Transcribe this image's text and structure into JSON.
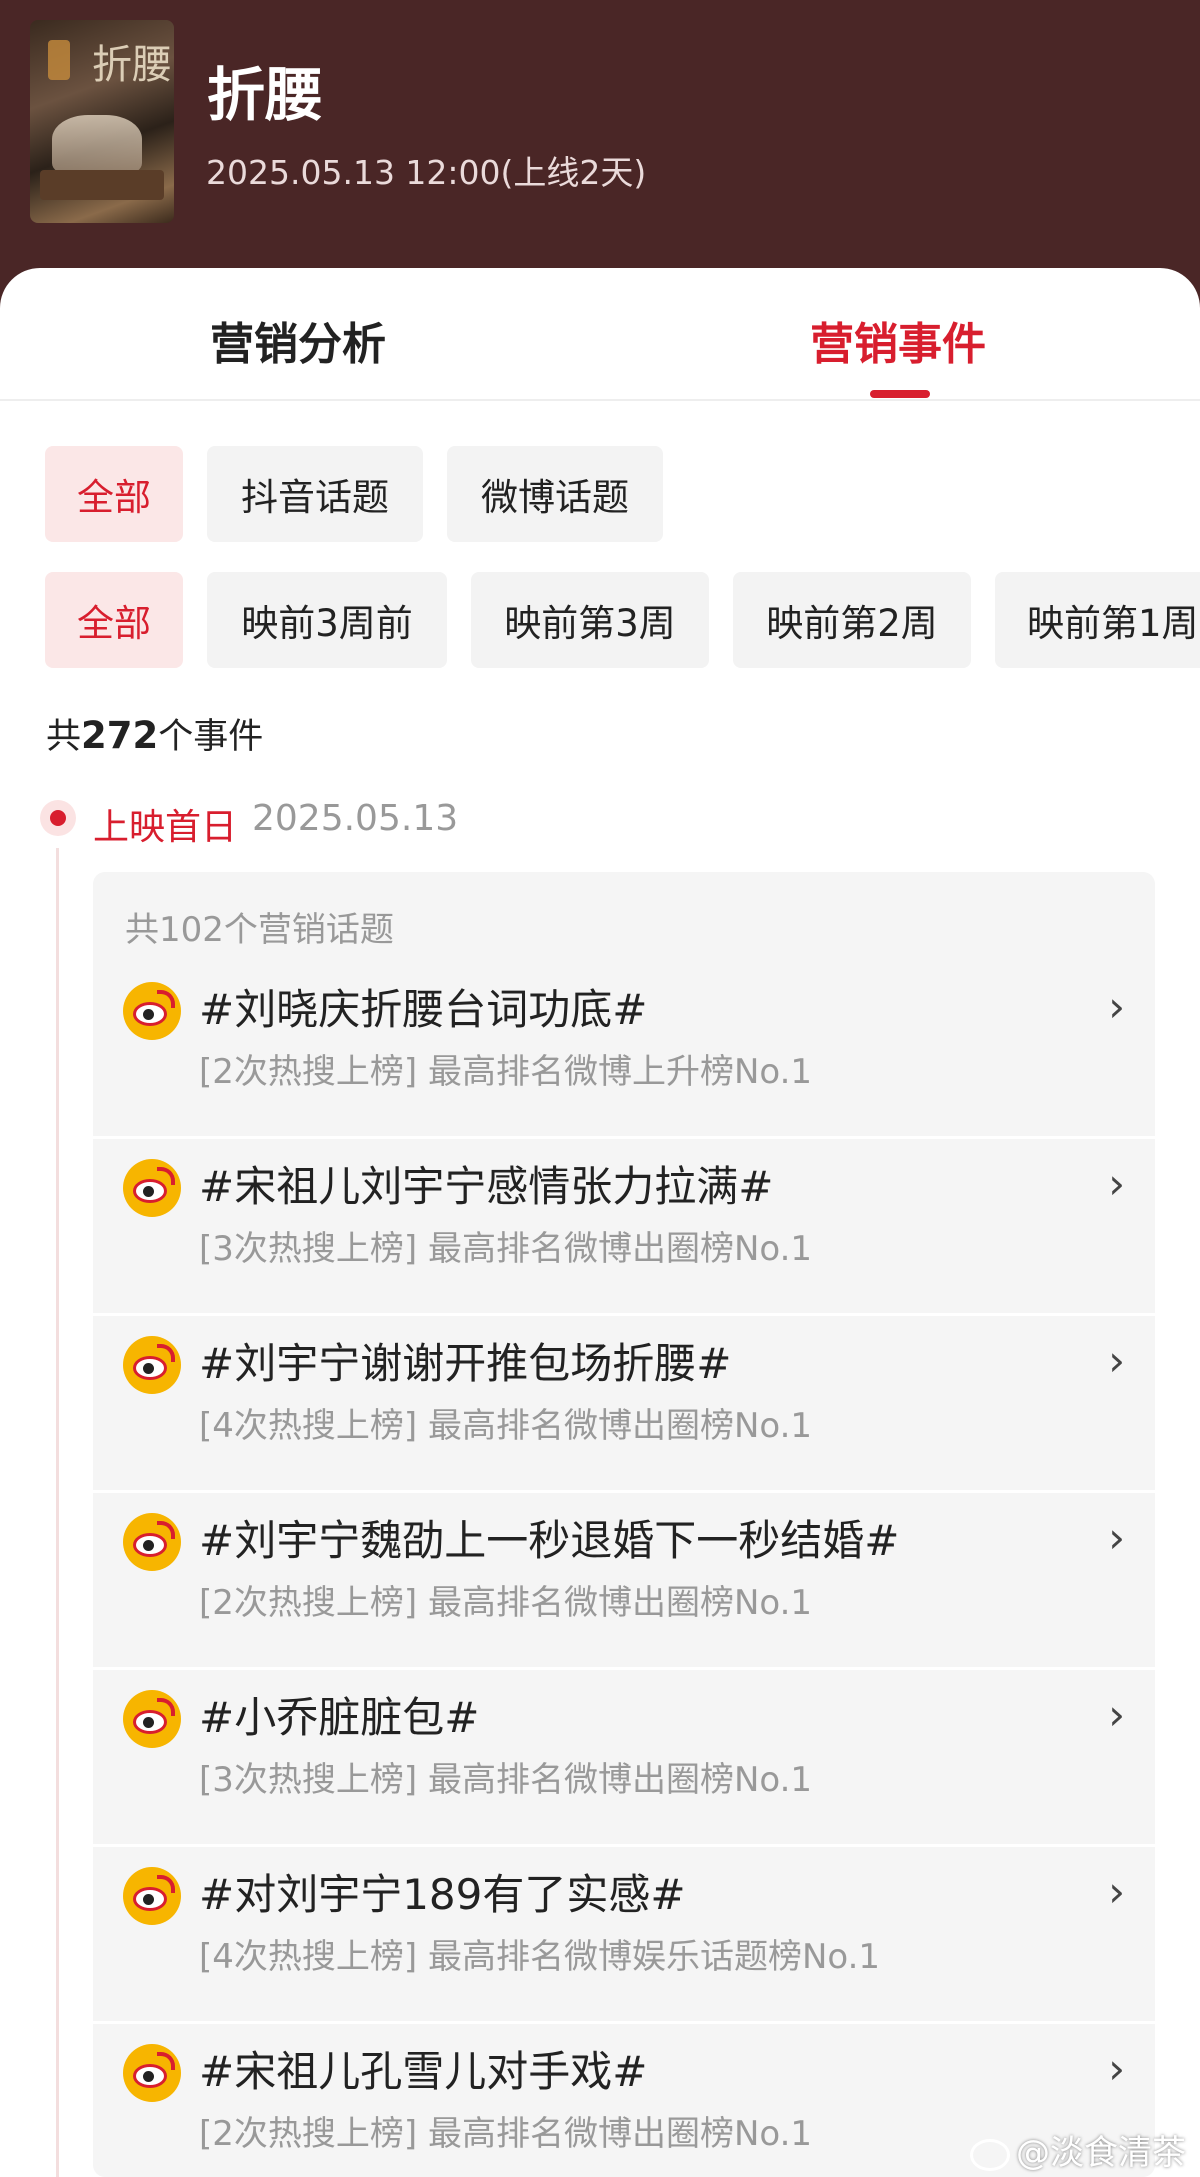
{
  "header": {
    "title": "折腰",
    "subtitle": "2025.05.13 12:00(上线2天)",
    "poster_glyph": "折腰"
  },
  "tabs": [
    {
      "label": "营销分析"
    },
    {
      "label": "营销事件"
    }
  ],
  "colors": {
    "accent": "#d81e2e",
    "header_bg": "#4a2626",
    "chip_bg": "#f3f3f3",
    "chip_active_bg": "#fbe7e7"
  },
  "filters_source": [
    "全部",
    "抖音话题",
    "微博话题"
  ],
  "filters_time": [
    "全部",
    "映前3周前",
    "映前第3周",
    "映前第2周",
    "映前第1周"
  ],
  "count": {
    "prefix": "共",
    "value": "272",
    "suffix": "个事件"
  },
  "timeline": {
    "label": "上映首日",
    "date": "2025.05.13"
  },
  "card": {
    "head": "共102个营销话题",
    "topics": [
      {
        "title": "#刘晓庆折腰台词功底#",
        "meta": "[2次热搜上榜] 最高排名微博上升榜No.1"
      },
      {
        "title": "#宋祖儿刘宇宁感情张力拉满#",
        "meta": "[3次热搜上榜] 最高排名微博出圈榜No.1"
      },
      {
        "title": "#刘宇宁谢谢开推包场折腰#",
        "meta": "[4次热搜上榜] 最高排名微博出圈榜No.1"
      },
      {
        "title": "#刘宇宁魏劭上一秒退婚下一秒结婚#",
        "meta": "[2次热搜上榜] 最高排名微博出圈榜No.1"
      },
      {
        "title": "#小乔脏脏包#",
        "meta": "[3次热搜上榜] 最高排名微博出圈榜No.1"
      },
      {
        "title": "#对刘宇宁189有了实感#",
        "meta": "[4次热搜上榜] 最高排名微博娱乐话题榜No.1"
      },
      {
        "title": "#宋祖儿孔雪儿对手戏#",
        "meta": "[2次热搜上榜] 最高排名微博出圈榜No.1"
      }
    ],
    "chevron": "›"
  },
  "watermark": "@淡食清茶"
}
